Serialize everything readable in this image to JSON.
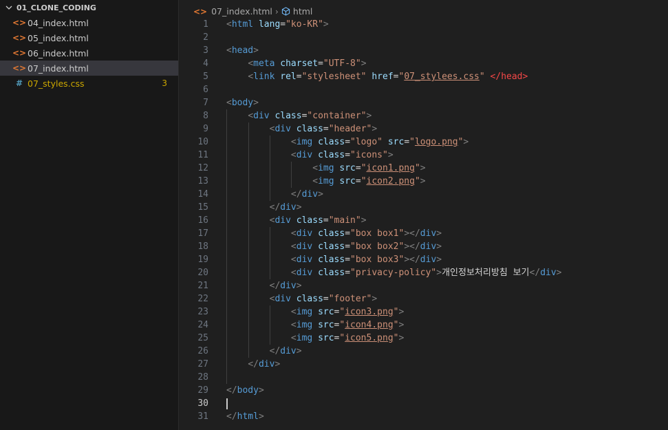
{
  "explorer": {
    "folder": "01_CLONE_CODING",
    "files": [
      {
        "name": "04_index.html",
        "type": "html",
        "active": false
      },
      {
        "name": "05_index.html",
        "type": "html",
        "active": false
      },
      {
        "name": "06_index.html",
        "type": "html",
        "active": false
      },
      {
        "name": "07_index.html",
        "type": "html",
        "active": true
      },
      {
        "name": "07_styles.css",
        "type": "css",
        "active": false,
        "problems": "3"
      }
    ]
  },
  "breadcrumb": {
    "file": "07_index.html",
    "symbol": "html"
  },
  "editor": {
    "current_line": "30",
    "line_numbers": [
      "1",
      "2",
      "3",
      "4",
      "5",
      "6",
      "7",
      "8",
      "9",
      "10",
      "11",
      "12",
      "13",
      "14",
      "15",
      "16",
      "17",
      "18",
      "19",
      "20",
      "21",
      "22",
      "23",
      "24",
      "25",
      "26",
      "27",
      "28",
      "29",
      "30",
      "31"
    ]
  },
  "colors": {
    "tag": "#569cd6",
    "attribute": "#9cdcfe",
    "string": "#ce9178",
    "html_icon": "#e37933",
    "css_icon": "#519aba",
    "warning": "#cca700"
  }
}
